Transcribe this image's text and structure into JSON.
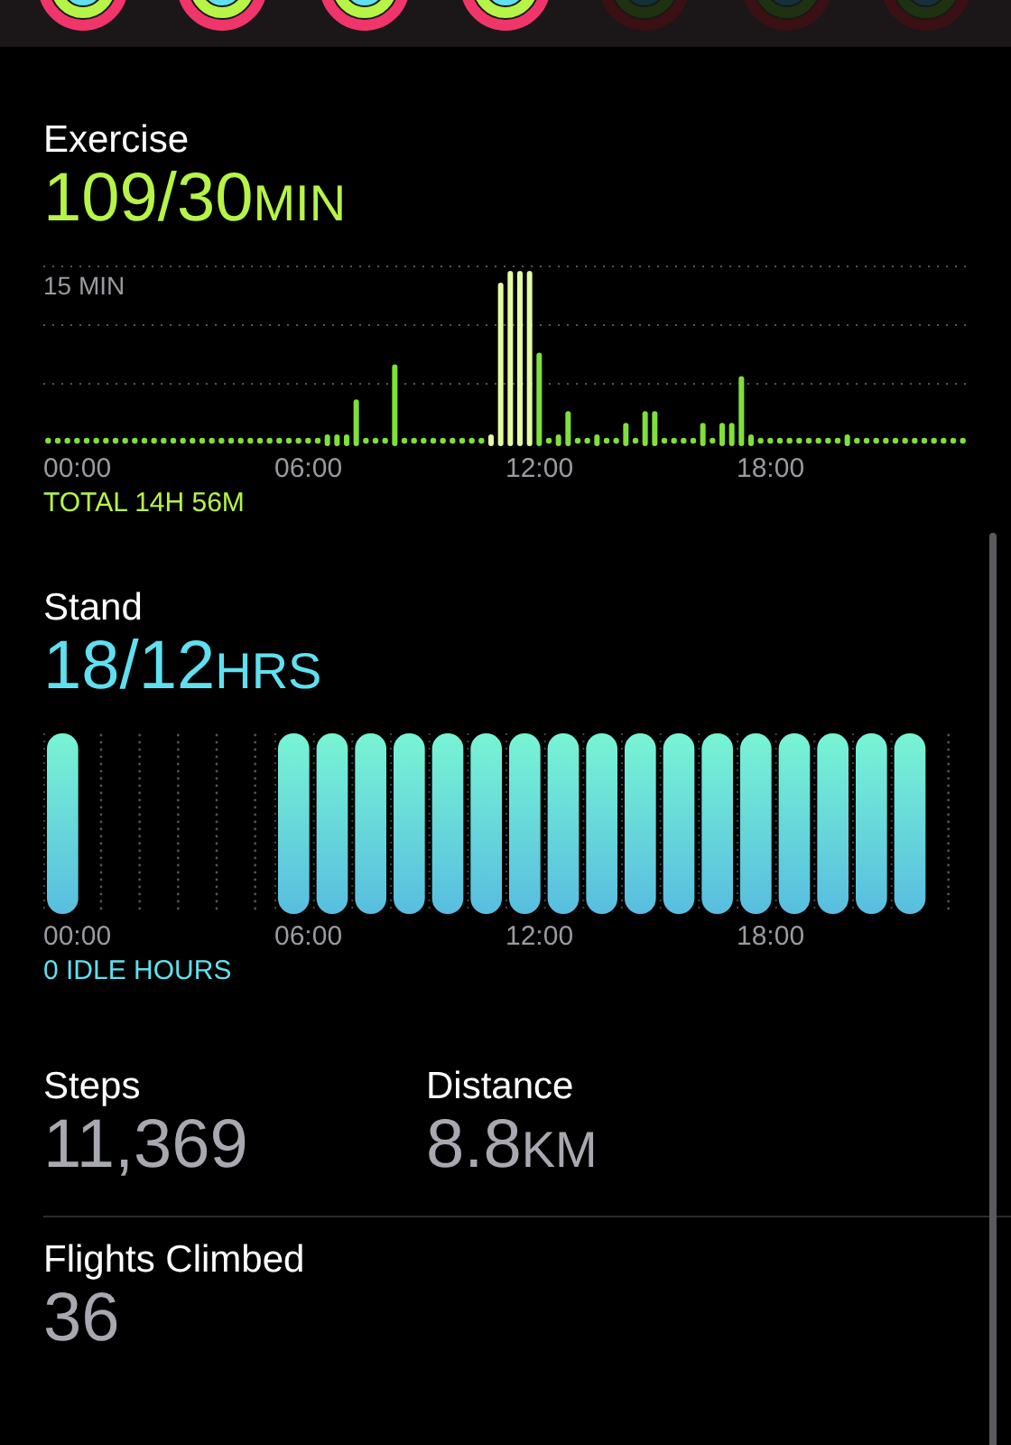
{
  "rings": [
    {
      "active": true
    },
    {
      "active": true
    },
    {
      "active": true
    },
    {
      "active": true
    },
    {
      "active": false
    },
    {
      "active": false
    },
    {
      "active": false
    }
  ],
  "exercise": {
    "title": "Exercise",
    "value": "109/30",
    "unit": "MIN",
    "y_label": "15 MIN",
    "axis_labels": [
      "00:00",
      "06:00",
      "12:00",
      "18:00"
    ],
    "summary": "TOTAL 14H 56M"
  },
  "stand": {
    "title": "Stand",
    "value": "18/12",
    "unit": "HRS",
    "hours": [
      {
        "stood": true
      },
      {
        "stood": false
      },
      {
        "stood": false
      },
      {
        "stood": false
      },
      {
        "stood": false
      },
      {
        "stood": false
      },
      {
        "stood": true
      },
      {
        "stood": true
      },
      {
        "stood": true
      },
      {
        "stood": true
      },
      {
        "stood": true
      },
      {
        "stood": true
      },
      {
        "stood": true
      },
      {
        "stood": true
      },
      {
        "stood": true
      },
      {
        "stood": true
      },
      {
        "stood": true
      },
      {
        "stood": true
      },
      {
        "stood": true
      },
      {
        "stood": true
      },
      {
        "stood": true
      },
      {
        "stood": true
      },
      {
        "stood": true
      },
      {
        "stood": false
      }
    ],
    "axis_labels": [
      "00:00",
      "06:00",
      "12:00",
      "18:00"
    ],
    "summary": "0 IDLE HOURS"
  },
  "stats": [
    {
      "label": "Steps",
      "value": "11,369"
    },
    {
      "label": "Distance",
      "value": "8.8",
      "unit": "KM"
    },
    {
      "label": "Flights Climbed",
      "value": "36"
    }
  ]
}
